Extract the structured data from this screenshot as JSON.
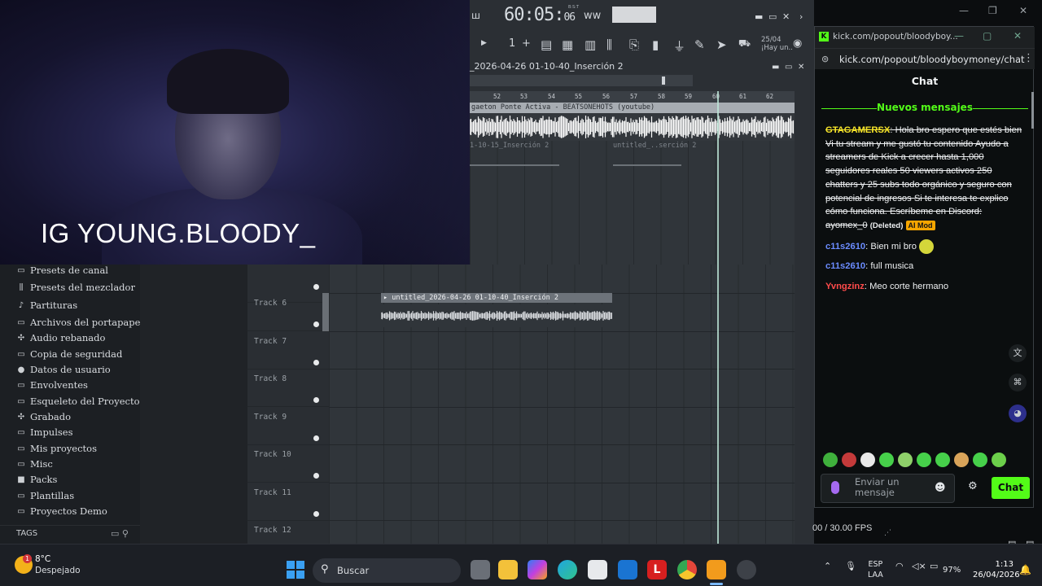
{
  "overlay": {
    "ig_handle": "IG YOUNG.BLOODY_"
  },
  "fl_studio": {
    "time": "60:05",
    "time_sub": "06",
    "time_sub_top": "B:S:T",
    "pattern_num": "1",
    "date_label": "25/04",
    "hint_label": "¡Hay un..",
    "playlist_title": "_2026-04-26 01-10-40_Inserción 2",
    "ruler_numbers": [
      "52",
      "53",
      "54",
      "55",
      "56",
      "57",
      "58",
      "59",
      "60",
      "61",
      "62"
    ],
    "top_clip_title": "gaeton Ponte Activa - BEATSONEHOTS (youtube)",
    "ghost_clip_1": "1-10-15_Inserción 2",
    "ghost_clip_2": "untitled_..serción 2",
    "track_clip_title": "untitled_2026-04-26 01-10-40_Inserción 2",
    "tracks": [
      "Track 6",
      "Track 7",
      "Track 8",
      "Track 9",
      "Track 10",
      "Track 11",
      "Track 12"
    ]
  },
  "browser": {
    "items": [
      {
        "label": "Presets de canal",
        "icon": "folder-icon"
      },
      {
        "label": "Presets del mezclador",
        "icon": "mixer-icon"
      },
      {
        "label": "Partituras",
        "icon": "note-icon"
      },
      {
        "label": "Archivos del portapapeles",
        "icon": "folder-icon"
      },
      {
        "label": "Audio rebanado",
        "icon": "slice-icon"
      },
      {
        "label": "Copia de seguridad",
        "icon": "backup-icon"
      },
      {
        "label": "Datos de usuario",
        "icon": "user-icon"
      },
      {
        "label": "Envolventes",
        "icon": "folder-icon"
      },
      {
        "label": "Esqueleto del Proyecto",
        "icon": "folder-icon"
      },
      {
        "label": "Grabado",
        "icon": "record-icon"
      },
      {
        "label": "Impulses",
        "icon": "folder-icon"
      },
      {
        "label": "Mis proyectos",
        "icon": "folder-icon"
      },
      {
        "label": "Misc",
        "icon": "folder-icon"
      },
      {
        "label": "Packs",
        "icon": "pack-icon"
      },
      {
        "label": "Plantillas",
        "icon": "folder-icon"
      },
      {
        "label": "Proyectos Demo",
        "icon": "folder-icon"
      }
    ],
    "tags_label": "TAGS"
  },
  "chat_window": {
    "tab_title": "kick.com/popout/bloodyboy...",
    "url": "kick.com/popout/bloodyboymoney/chat",
    "header": "Chat",
    "new_messages": "Nuevos mensajes",
    "messages": [
      {
        "user": "GTAGAMERSX",
        "user_color": "#f7e52a",
        "text": "Hola bro espero que estés bien Vi tu stream y me gustó tu contenido Ayudo a streamers de Kick a crecer hasta 1,000 seguidores reales 50 viewers activos 250 chatters y 25 subs todo orgánico y seguro con potencial de ingresos Si te interesa te explico cómo funciona. Escríbeme en Discord: ayomex_0",
        "deleted": "(Deleted)",
        "badge": "AI Mod"
      },
      {
        "user": "c11s2610",
        "user_color": "#6b8cff",
        "text": "Bien mi bro"
      },
      {
        "user": "c11s2610",
        "user_color": "#6b8cff",
        "text": "full musica"
      },
      {
        "user": "Yvngzinz",
        "user_color": "#ff4b4b",
        "text": "Meo corte hermano"
      }
    ],
    "input_placeholder": "Enviar un mensaje",
    "send_label": "Chat"
  },
  "fps": "00 / 30.00 FPS",
  "taskbar": {
    "temp": "8°C",
    "weather": "Despejado",
    "weather_badge": "1",
    "search_placeholder": "Buscar",
    "lang_1": "ESP",
    "lang_2": "LAA",
    "battery": "97%",
    "time": "1:13",
    "date": "26/04/2026"
  },
  "colors": {
    "kick_green": "#53fc18",
    "mod_badge": "#f7a600",
    "ig_text": "#ffffff"
  }
}
